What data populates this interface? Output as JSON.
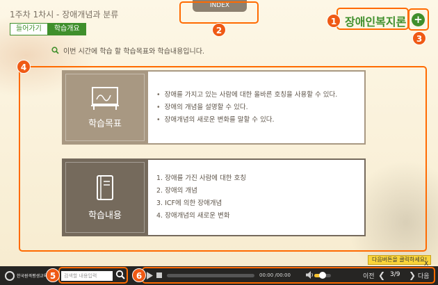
{
  "lesson": {
    "title": "1주차 1차시 - 장애개념과 분류"
  },
  "tabs": [
    {
      "label": "들어가기"
    },
    {
      "label": "학습개요"
    }
  ],
  "index": {
    "label": "INDEX"
  },
  "subject": {
    "title": "장애인복지론",
    "plus": "+"
  },
  "intro": {
    "text": "이번 시간에 학습 할 학습목표와 학습내용입니다."
  },
  "goals": {
    "heading": "학습목표",
    "items": [
      "장애를 가지고 있는 사람에 대한 올바른 호칭을 사용할 수 있다.",
      "장애의 개념을 설명할 수 있다.",
      "장애개념의 새로운 변화를 말할 수 있다."
    ]
  },
  "contents": {
    "heading": "학습내용",
    "items": [
      "1. 장애를 가진 사람에 대한 호칭",
      "2. 장애의 개념",
      "3. ICF에 의한 장애개념",
      "4. 장애개념의 새로운 변화"
    ]
  },
  "annotations": [
    "1",
    "2",
    "3",
    "4",
    "5",
    "6"
  ],
  "player": {
    "brand": "한국원격평생교육원",
    "search_placeholder": "검색할 내용입력",
    "time": "00:00 /00:00",
    "volume_level": 0.5,
    "prev_label": "이전",
    "page": "3/9",
    "next_label": "다음",
    "tooltip": "다음버튼을 클릭하세요!",
    "tooltip_close": "X"
  },
  "colors": {
    "green": "#3f8f2c",
    "annotation": "#ff6a00",
    "goal_panel": "#a89882",
    "content_panel": "#756a5c",
    "player_bg": "#262523"
  }
}
